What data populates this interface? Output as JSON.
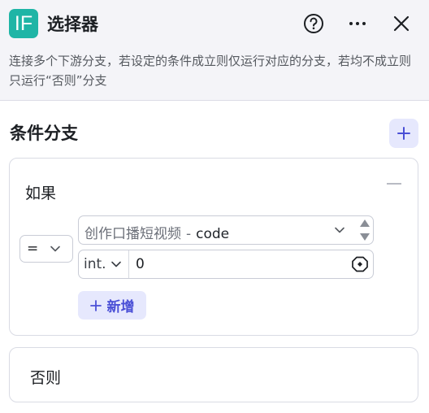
{
  "header": {
    "logo_text": "IF",
    "title": "选择器",
    "description": "连接多个下游分支，若设定的条件成立则仅运行对应的分支，若均不成立则只运行“否则”分支",
    "icons": [
      "help-icon",
      "more-icon",
      "close-icon"
    ]
  },
  "section": {
    "title": "条件分支",
    "add_icon": "plus-icon"
  },
  "if_branch": {
    "label": "如果",
    "operator": "=",
    "variable": {
      "name": "创作口播短视频",
      "separator": "-",
      "field": "code"
    },
    "value_type": "int.",
    "value": "0",
    "add_button_label": "新增"
  },
  "else_branch": {
    "label": "否则"
  },
  "colors": {
    "logo_bg": "#1fb5a6",
    "accent": "#4a4fd6",
    "accent_bg": "#e6e8fd",
    "header_bg": "#f4f4f8"
  }
}
